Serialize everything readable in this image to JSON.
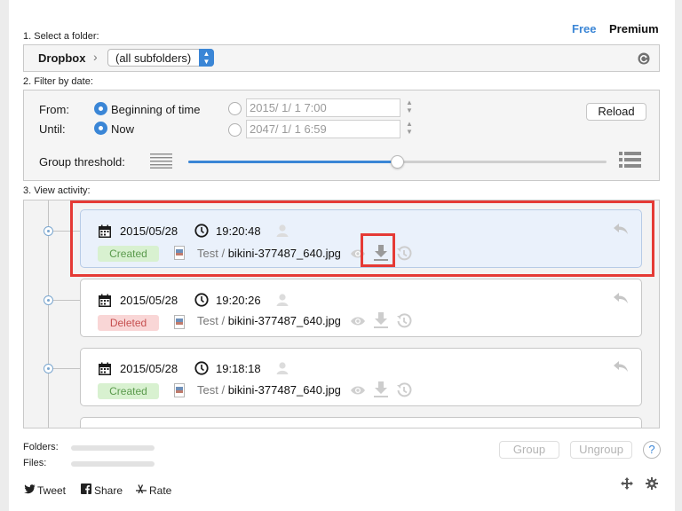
{
  "plan": {
    "free": "Free",
    "premium": "Premium"
  },
  "folder": {
    "section_label": "1. Select a folder:",
    "root": "Dropbox",
    "subfolder_value": "(all subfolders)"
  },
  "filter": {
    "section_label": "2. Filter by date:",
    "from_label": "From:",
    "until_label": "Until:",
    "from_option": "Beginning of time",
    "until_option": "Now",
    "from_date": "2015/  1/  1   7:00",
    "until_date": "2047/  1/  1   6:59",
    "reload_label": "Reload",
    "group_threshold_label": "Group threshold:",
    "threshold_level": 0.5
  },
  "activity": {
    "section_label": "3. View activity:",
    "items": [
      {
        "date": "2015/05/28",
        "time": "19:20:48",
        "status": "Created",
        "folder": "Test /",
        "file": "bikini-377487_640.jpg",
        "selected": true
      },
      {
        "date": "2015/05/28",
        "time": "19:20:26",
        "status": "Deleted",
        "folder": "Test /",
        "file": "bikini-377487_640.jpg",
        "selected": false
      },
      {
        "date": "2015/05/28",
        "time": "19:18:18",
        "status": "Created",
        "folder": "Test /",
        "file": "bikini-377487_640.jpg",
        "selected": false
      }
    ]
  },
  "stats": {
    "folders_label": "Folders:",
    "files_label": "Files:"
  },
  "buttons": {
    "group": "Group",
    "ungroup": "Ungroup",
    "help": "?"
  },
  "footer": {
    "tweet": "Tweet",
    "share": "Share",
    "rate": "Rate"
  },
  "colors": {
    "accent": "#3b86d6",
    "highlight": "#e53a35",
    "created_bg": "#d8f1d0",
    "deleted_bg": "#f9d6d6"
  }
}
